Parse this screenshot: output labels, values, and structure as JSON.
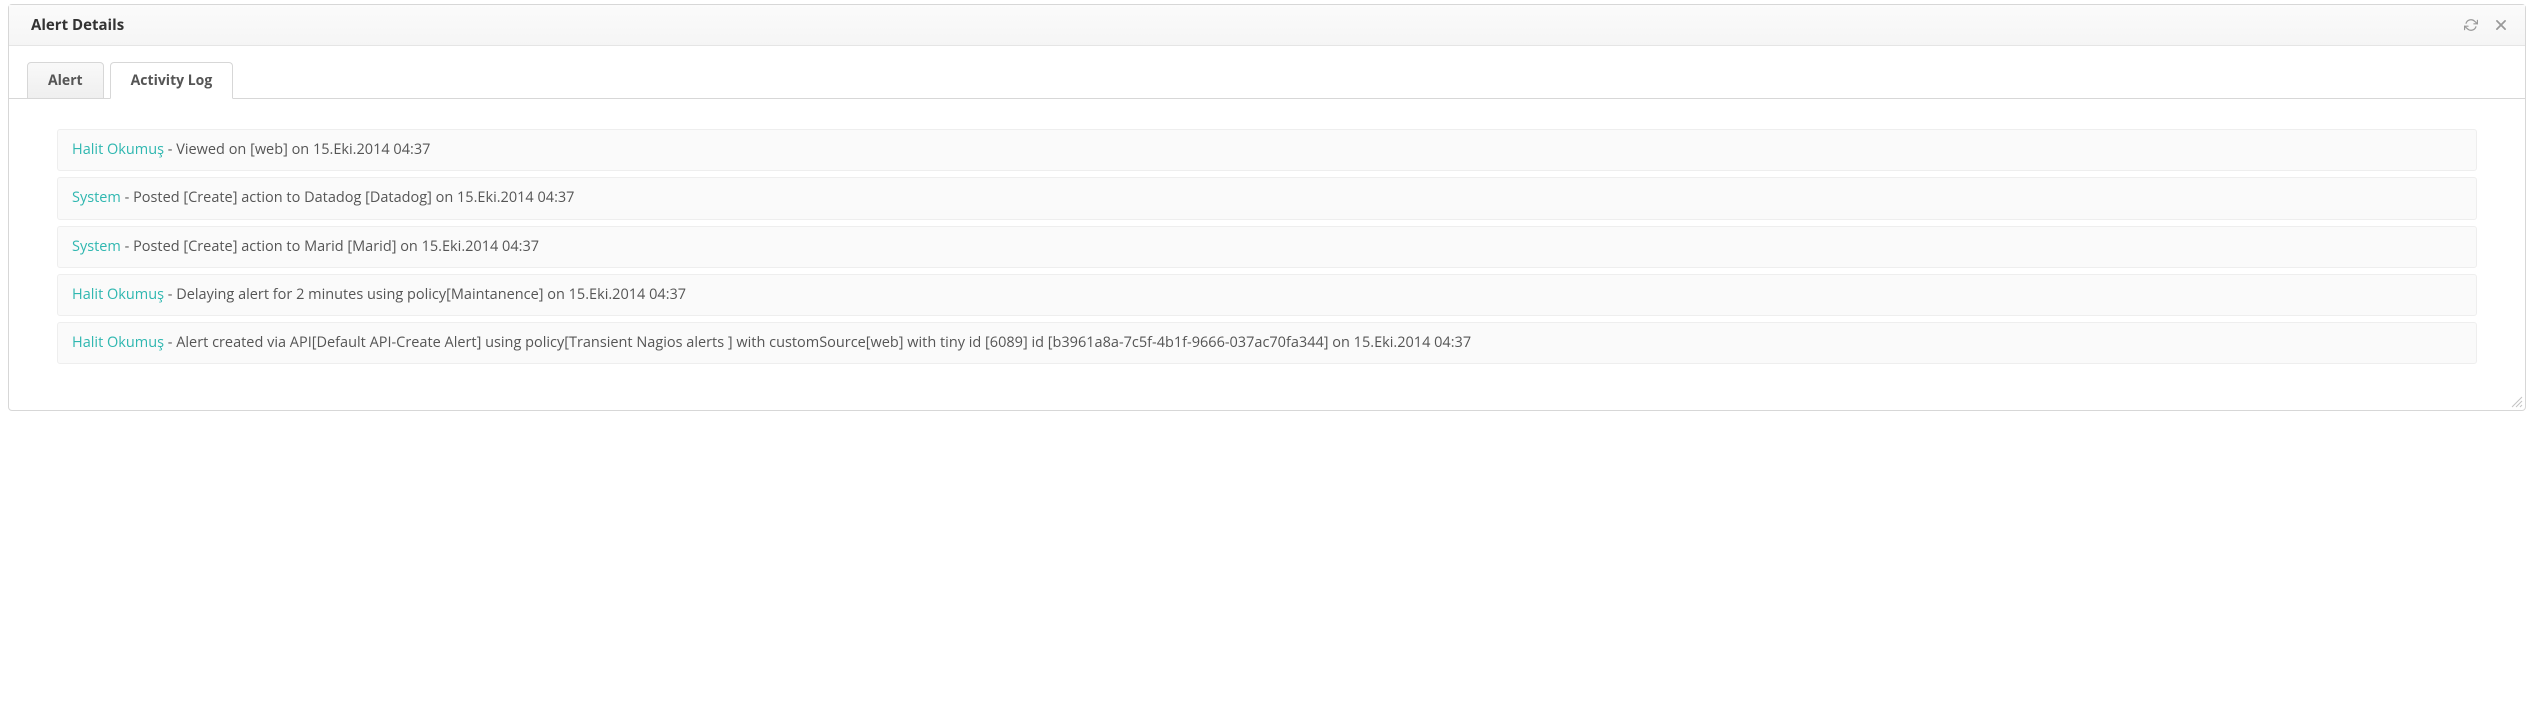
{
  "header": {
    "title": "Alert Details"
  },
  "tabs": {
    "alert": "Alert",
    "activity_log": "Activity Log"
  },
  "log": [
    {
      "actor": "Halit Okumuş",
      "msg": " - Viewed on [web] on 15.Eki.2014 04:37"
    },
    {
      "actor": "System",
      "msg": " - Posted [Create] action to Datadog [Datadog] on 15.Eki.2014 04:37"
    },
    {
      "actor": "System",
      "msg": " - Posted [Create] action to Marid [Marid] on 15.Eki.2014 04:37"
    },
    {
      "actor": "Halit Okumuş",
      "msg": " - Delaying alert for 2 minutes using policy[Maintanence] on 15.Eki.2014 04:37"
    },
    {
      "actor": "Halit Okumuş",
      "msg": " - Alert created via API[Default API-Create Alert] using policy[Transient Nagios alerts ] with customSource[web] with tiny id [6089] id [b3961a8a-7c5f-4b1f-9666-037ac70fa344] on 15.Eki.2014 04:37"
    }
  ]
}
